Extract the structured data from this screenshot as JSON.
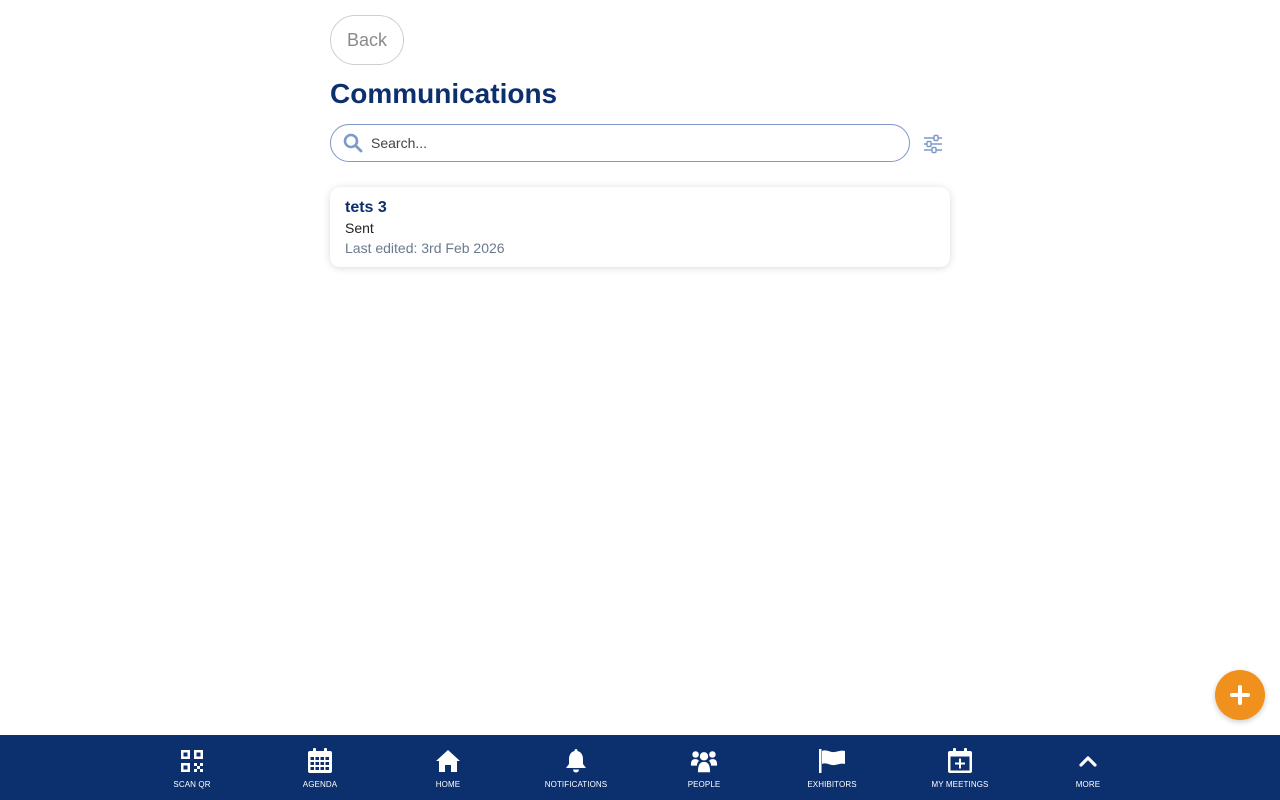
{
  "header": {
    "back_label": "Back",
    "title": "Communications"
  },
  "search": {
    "placeholder": "Search...",
    "value": ""
  },
  "communications": [
    {
      "title": "tets 3",
      "status": "Sent",
      "edited": "Last edited: 3rd Feb 2026"
    }
  ],
  "fab": {
    "icon": "plus-icon"
  },
  "bottom_nav": [
    {
      "label": "SCAN QR",
      "icon": "qr-code-icon"
    },
    {
      "label": "AGENDA",
      "icon": "calendar-icon"
    },
    {
      "label": "HOME",
      "icon": "home-icon"
    },
    {
      "label": "NOTIFICATIONS",
      "icon": "bell-icon"
    },
    {
      "label": "PEOPLE",
      "icon": "people-icon"
    },
    {
      "label": "EXHIBITORS",
      "icon": "flag-icon"
    },
    {
      "label": "MY MEETINGS",
      "icon": "calendar-plus-icon"
    },
    {
      "label": "MORE",
      "icon": "chevron-up-icon"
    }
  ],
  "colors": {
    "primary": "#0c2f6e",
    "accent": "#f0901d",
    "search_border": "#7d99c7"
  }
}
